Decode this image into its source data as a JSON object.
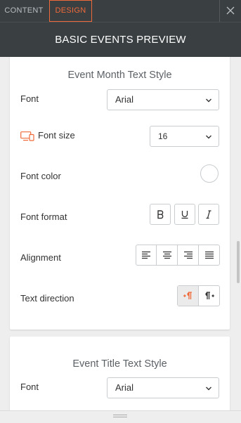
{
  "tabs": {
    "content": "CONTENT",
    "design": "DESIGN"
  },
  "header": {
    "title": "BASIC EVENTS PREVIEW"
  },
  "colors": {
    "accent": "#ef6a3a",
    "topbar": "#3a3f42"
  },
  "section_month": {
    "title": "Event Month Text Style",
    "font_label": "Font",
    "font_value": "Arial",
    "font_size_label": "Font size",
    "font_size_value": "16",
    "font_size_icon": "desktop-mobile-icon",
    "font_color_label": "Font color",
    "font_format_label": "Font format",
    "format_buttons": [
      "bold",
      "underline",
      "italic"
    ],
    "alignment_label": "Alignment",
    "alignment_buttons": [
      "align-left",
      "align-center",
      "align-right",
      "align-justify"
    ],
    "text_direction_label": "Text direction",
    "text_direction_selected": "ltr"
  },
  "section_title": {
    "title": "Event Title Text Style",
    "font_label": "Font",
    "font_value": "Arial"
  }
}
